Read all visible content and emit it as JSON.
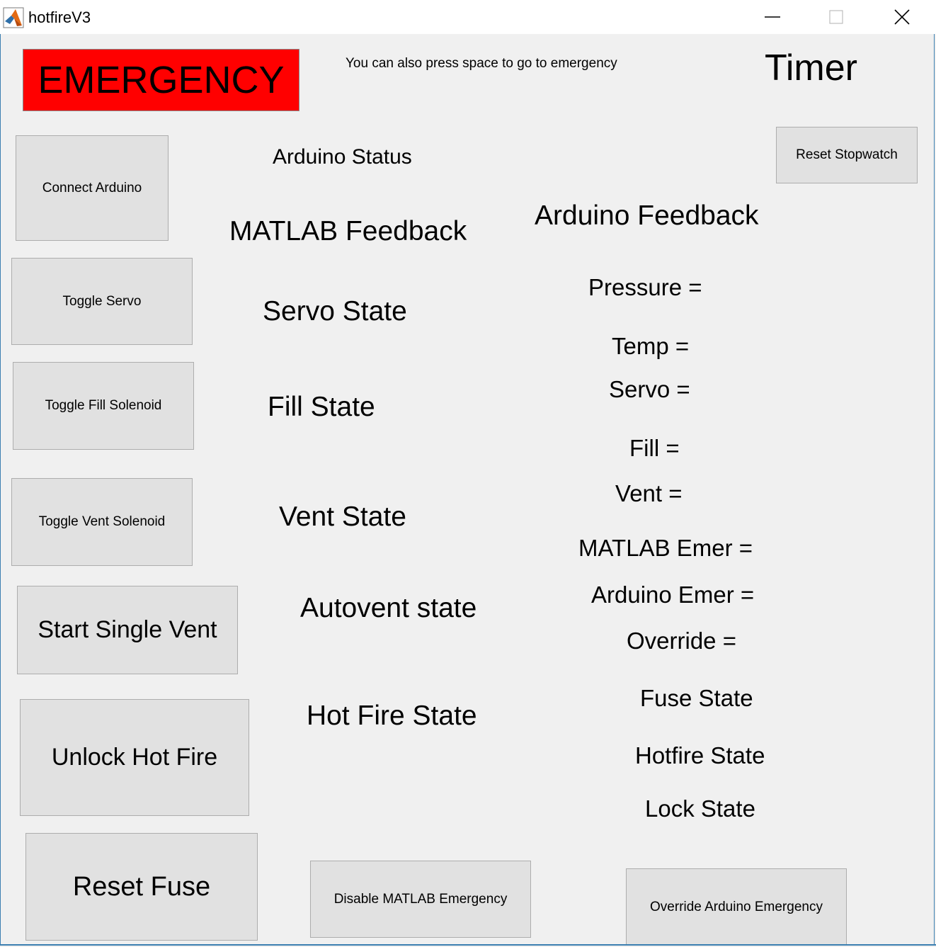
{
  "window": {
    "title": "hotfireV3",
    "minimize_icon": "minimize-icon",
    "maximize_icon": "maximize-icon",
    "close_icon": "close-icon",
    "app_icon": "matlab-icon"
  },
  "buttons": {
    "emergency": "EMERGENCY",
    "connect_arduino": "Connect Arduino",
    "toggle_servo": "Toggle Servo",
    "toggle_fill": "Toggle Fill Solenoid",
    "toggle_vent": "Toggle Vent Solenoid",
    "start_single_vent": "Start Single Vent",
    "unlock_hot_fire": "Unlock Hot Fire",
    "reset_fuse": "Reset Fuse",
    "disable_matlab_emergency": "Disable MATLAB Emergency",
    "override_arduino_emergency": "Override Arduino Emergency",
    "reset_stopwatch": "Reset Stopwatch"
  },
  "labels": {
    "space_hint": "You can also press space to go to emergency",
    "timer": "Timer",
    "arduino_status": "Arduino Status",
    "matlab_feedback": "MATLAB Feedback",
    "servo_state": "Servo State",
    "fill_state": "Fill State",
    "vent_state": "Vent State",
    "autovent_state": "Autovent state",
    "hot_fire_state": "Hot Fire State",
    "arduino_feedback": "Arduino Feedback",
    "pressure": "Pressure =",
    "temp": "Temp =",
    "servo": "Servo =",
    "fill": "Fill =",
    "vent": "Vent =",
    "matlab_emer": "MATLAB Emer =",
    "arduino_emer": "Arduino Emer =",
    "override": "Override =",
    "fuse_state": "Fuse State",
    "hotfire_state": "Hotfire State",
    "lock_state": "Lock State"
  },
  "colors": {
    "emergency_bg": "#ff0000",
    "button_bg": "#e1e1e1",
    "window_bg": "#f0f0f0"
  }
}
